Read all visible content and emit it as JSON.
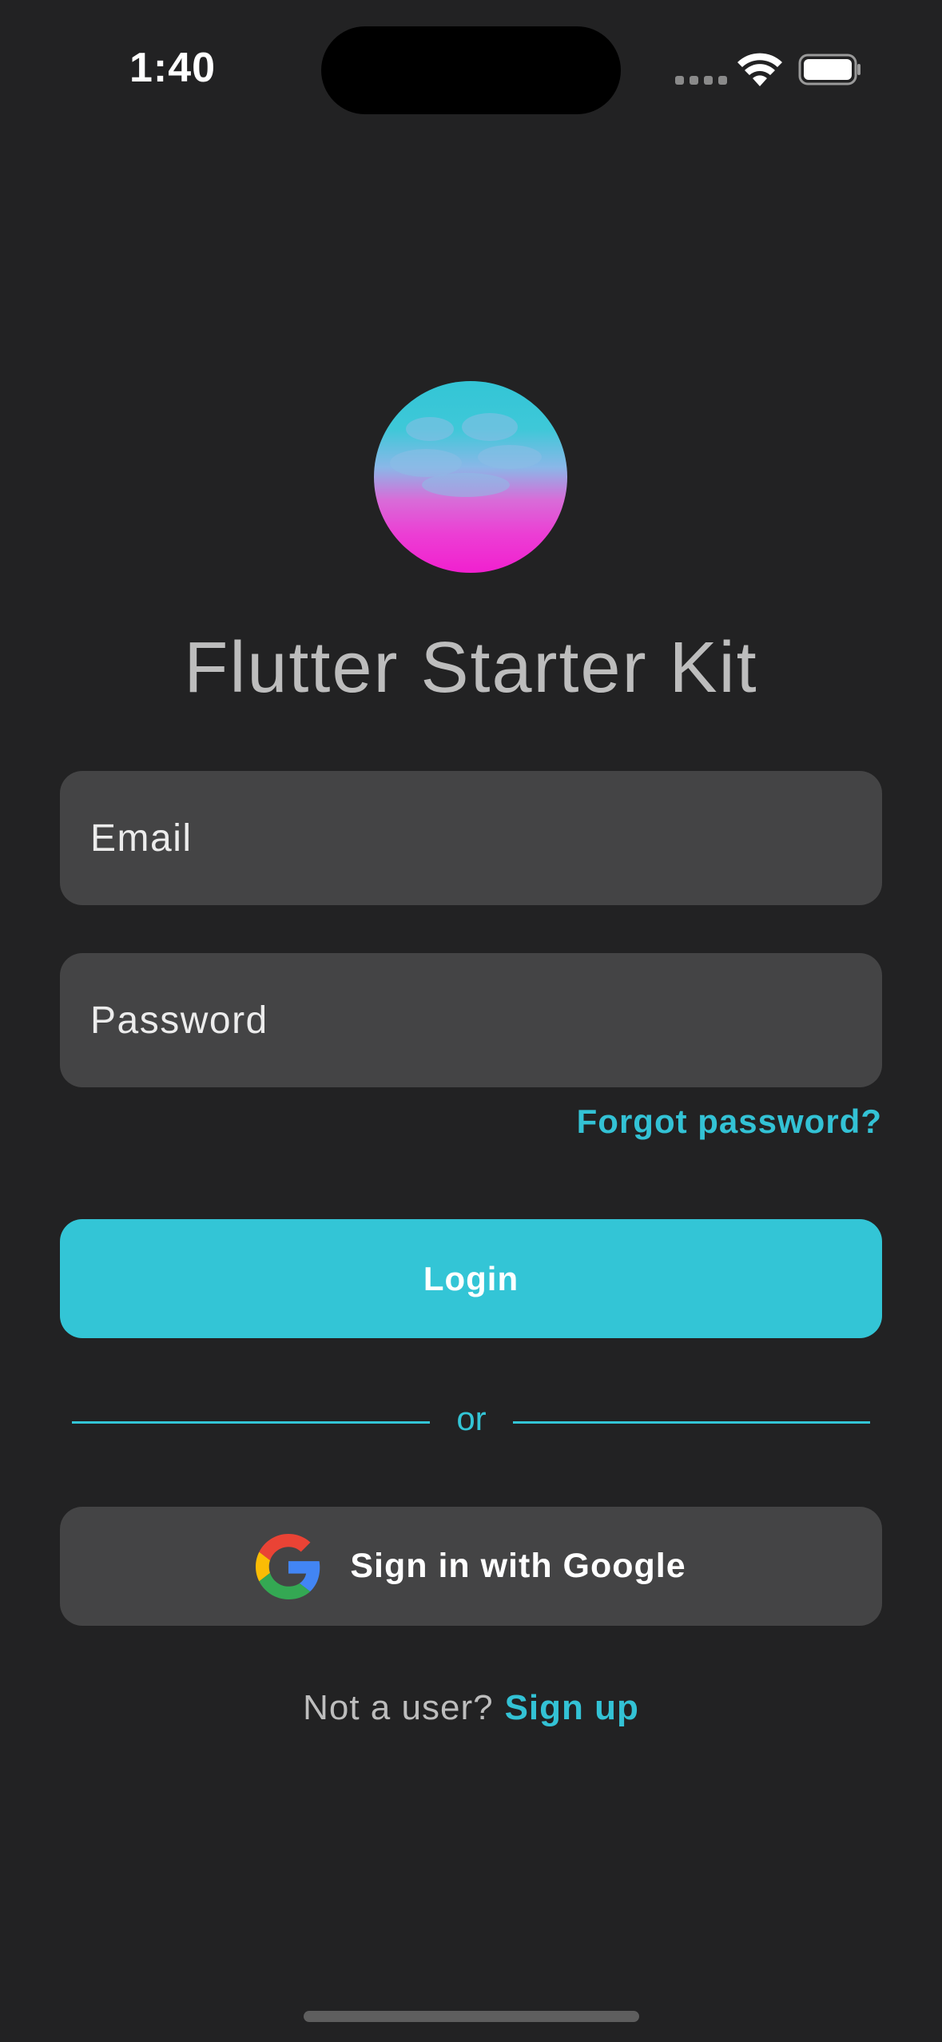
{
  "status_bar": {
    "time": "1:40",
    "icons": [
      "signal-icon",
      "wifi-icon",
      "battery-icon"
    ]
  },
  "app": {
    "title": "Flutter Starter Kit",
    "logo": "app-logo-gradient-circle"
  },
  "form": {
    "email_placeholder": "Email",
    "password_placeholder": "Password",
    "forgot_password": "Forgot password?",
    "login_label": "Login",
    "divider_text": "or",
    "google_label": "Sign in with Google",
    "signup_prompt": "Not a user?",
    "signup_link": "Sign up"
  },
  "colors": {
    "background": "#222223",
    "accent": "#33c5d6",
    "field_background": "#444445",
    "logo_top": "#33c5d6",
    "logo_bottom": "#f120cf"
  }
}
